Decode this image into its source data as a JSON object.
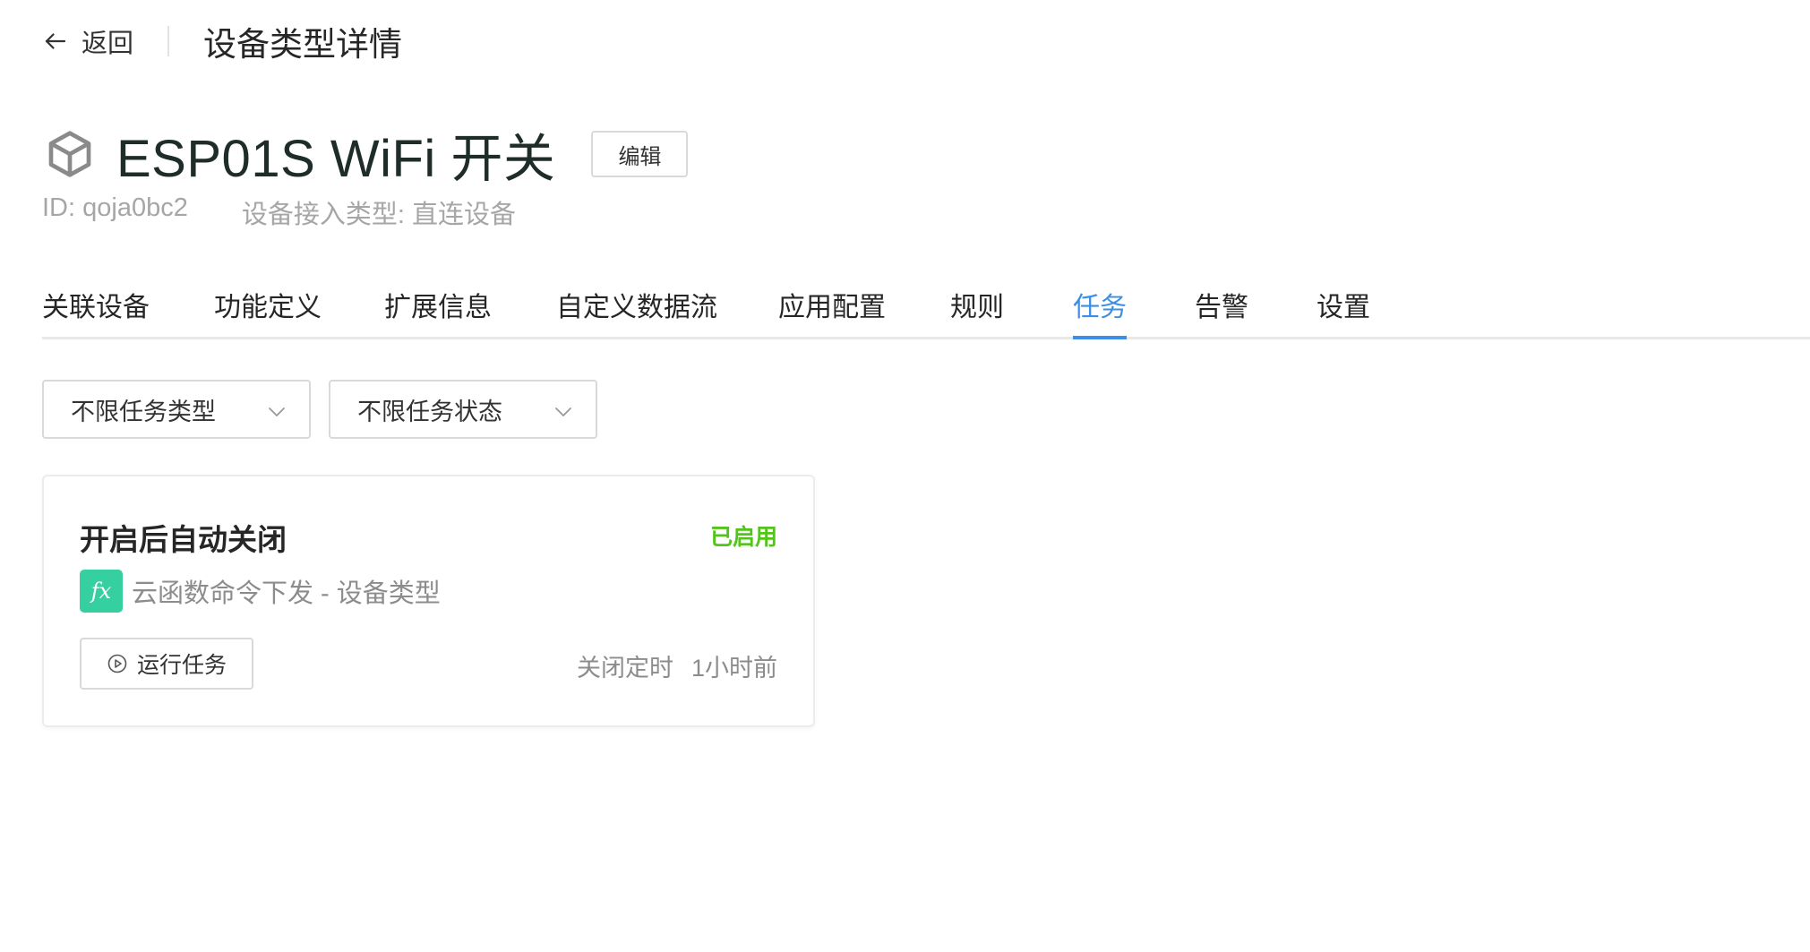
{
  "header": {
    "back_label": "返回",
    "page_title": "设备类型详情"
  },
  "device": {
    "name": "ESP01S WiFi 开关",
    "edit_label": "编辑",
    "id_text": "ID: qoja0bc2",
    "access_type_text": "设备接入类型: 直连设备"
  },
  "tabs": [
    {
      "label": "关联设备"
    },
    {
      "label": "功能定义"
    },
    {
      "label": "扩展信息"
    },
    {
      "label": "自定义数据流"
    },
    {
      "label": "应用配置"
    },
    {
      "label": "规则"
    },
    {
      "label": "任务"
    },
    {
      "label": "告警"
    },
    {
      "label": "设置"
    }
  ],
  "active_tab": "任务",
  "filters": {
    "task_type": "不限任务类型",
    "task_status": "不限任务状态"
  },
  "task_card": {
    "title": "开启后自动关闭",
    "status": "已启用",
    "fx_icon_text": "fx",
    "function_desc": "云函数命令下发 - 设备类型",
    "run_label": "运行任务",
    "trigger": "关闭定时",
    "time_ago": "1小时前"
  },
  "colors": {
    "accent": "#3d8ee6",
    "status_enabled": "#52c41a",
    "fx_badge": "#36cfa0"
  }
}
